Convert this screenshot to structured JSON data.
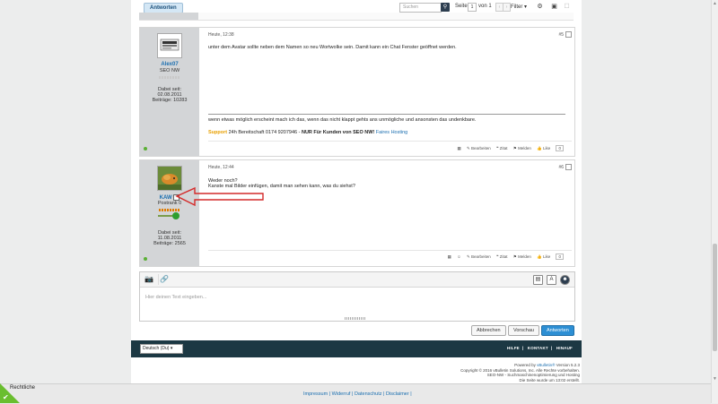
{
  "toolbar": {
    "reply_label": "Antworten",
    "search_placeholder": "Suchen",
    "page_label": "Seite",
    "page_value": "1",
    "page_of": "von 1",
    "filter_label": "Filter ▾"
  },
  "posts": [
    {
      "username": "Alex07",
      "rank": "SEO NW",
      "joined_label": "Dabei seit:",
      "joined_date": "02.08.2011",
      "posts_count": "Beiträge: 10283",
      "date": "Heute, 12:38",
      "number": "#5",
      "text": "unter dem Avatar sollte neben dem Namen so neu Wortwolke sein. Damit kann ein Chat Fenster geöffnet werden.",
      "signature_line1": "wenn etwas möglich erscheint mach ich das, wenn das nicht klappt gehts ans unmögliche und ansonsten das undenkbare.",
      "signature_brand": "Support",
      "signature_line2_mid": " 24h Bereitschaft 0174 9207946 - ",
      "signature_line2_bold": "NUR Für Kunden von SEO NW!",
      "signature_line2_link": " Faires Hosting",
      "actions": [
        "Bearbeiten",
        "Zitat",
        "Melden",
        "Like"
      ],
      "like_count": "0"
    },
    {
      "username": "KAW",
      "rank": "Postrank 0",
      "joined_label": "Dabei seit:",
      "joined_date": "11.08.2011",
      "posts_count": "Beiträge: 2565",
      "date": "Heute, 12:44",
      "number": "#6",
      "text_line1": "Weder noch?",
      "text_line2": "Kanste mal Bilder einfügen, damit man sehen kann, was du siehst?",
      "actions": [
        "Bearbeiten",
        "Zitat",
        "Melden",
        "Like"
      ],
      "like_count": "0"
    }
  ],
  "editor": {
    "placeholder": "Hier deinen Text eingeben..."
  },
  "buttons": {
    "cancel": "Abbrechen",
    "preview": "Vorschau",
    "submit": "Antworten"
  },
  "footer": {
    "language": "Deutsch (Du) ▾",
    "links": [
      "HILFE",
      "KONTAKT",
      "HINAUF"
    ],
    "credits_line1_prefix": "Powered by ",
    "credits_line1_link": "vBulletin®",
    "credits_line1_suffix": " Version 5.2.3",
    "credits_line2": "Copyright © 2016 vBulletin Solutions, Inc. Alle Rechte vorbehalten.",
    "credits_line3": "SEO-NW - Suchmaschinenoptimierung und Hosting",
    "credits_line4": "Die Seite wurde um 13:02 erstellt.",
    "rechtliche": "Rechtliche",
    "legal_links": "Impressum | Widerruf | Datenschutz | Disclaimer |"
  },
  "colors": {
    "accent": "#2d8fd4",
    "footer_bg": "#1c3843",
    "sidebar_bg": "#d3d5d7",
    "annotation": "#d42a2a"
  }
}
